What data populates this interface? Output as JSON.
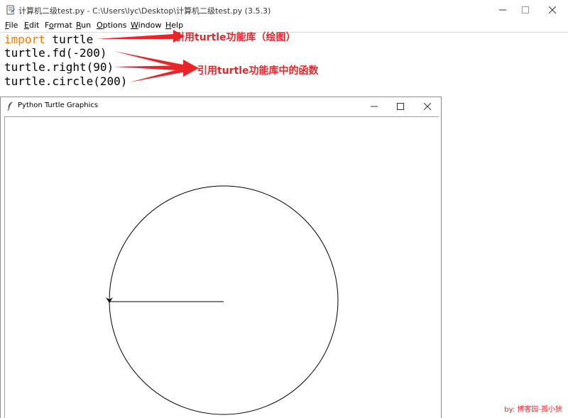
{
  "idle": {
    "title": "计算机二级test.py - C:\\Users\\lyc\\Desktop\\计算机二级test.py (3.5.3)",
    "menu": [
      {
        "key": "F",
        "rest": "ile"
      },
      {
        "key": "E",
        "rest": "dit"
      },
      {
        "key": "",
        "pre": "F",
        "key2": "o",
        "rest": "rmat"
      },
      {
        "key": "R",
        "rest": "un"
      },
      {
        "key": "O",
        "rest": "ptions"
      },
      {
        "key": "W",
        "rest": "indow"
      },
      {
        "key": "H",
        "rest": "elp"
      }
    ],
    "menu_labels": [
      "File",
      "Edit",
      "Format",
      "Run",
      "Options",
      "Window",
      "Help"
    ],
    "code": {
      "line1_kw": "import",
      "line1_rest": " turtle",
      "line2": "turtle.fd(-200)",
      "line3": "turtle.right(90)",
      "line4": "turtle.circle(200)"
    }
  },
  "annotations": {
    "first": "引用turtle功能库（绘图）",
    "second": "引用turtle功能库中的函数",
    "color": "#e8262a"
  },
  "turtle_window": {
    "title": "Python Turtle Graphics"
  },
  "watermark": "by: 博客园-孤小狄",
  "icons": {
    "idle_app": "idle-file-icon",
    "turtle_app": "feather-icon",
    "minimize": "minimize-icon",
    "maximize": "maximize-icon",
    "close": "close-icon"
  }
}
